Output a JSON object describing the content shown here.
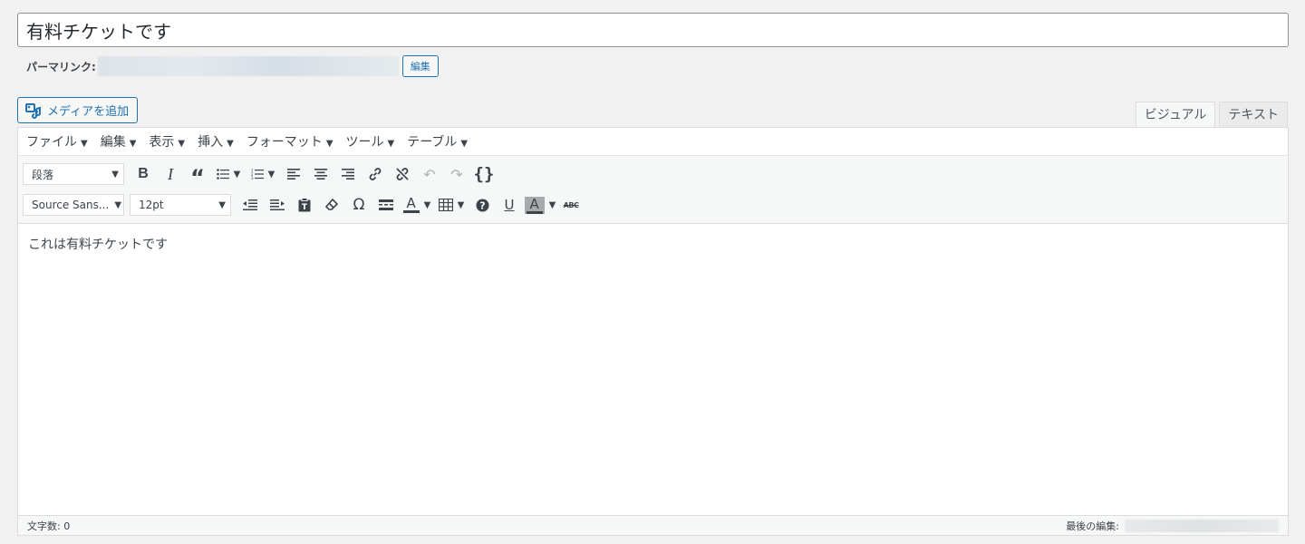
{
  "title": {
    "value": "有料チケットです"
  },
  "permalink": {
    "label": "パーマリンク:",
    "edit_label": "編集"
  },
  "media": {
    "button_label": "メディアを追加"
  },
  "tabs": [
    {
      "label": "ビジュアル",
      "active": true
    },
    {
      "label": "テキスト",
      "active": false
    }
  ],
  "menubar": [
    "ファイル",
    "編集",
    "表示",
    "挿入",
    "フォーマット",
    "ツール",
    "テーブル"
  ],
  "toolbar": {
    "format_select": "段落",
    "font_select": "Source Sans...",
    "size_select": "12pt",
    "row1_icons": [
      "bold-icon",
      "italic-icon",
      "blockquote-icon",
      "bullet-list-icon",
      "numbered-list-icon",
      "align-left-icon",
      "align-center-icon",
      "align-right-icon",
      "link-icon",
      "unlink-icon",
      "undo-icon",
      "redo-icon",
      "code-braces-icon"
    ],
    "row2_icons": [
      "outdent-icon",
      "indent-icon",
      "paste-text-icon",
      "clear-format-icon",
      "special-char-icon",
      "read-more-icon",
      "text-color-icon",
      "table-icon",
      "help-icon",
      "underline-icon",
      "background-color-icon",
      "strikethrough-icon"
    ]
  },
  "content": {
    "text": "これは有料チケットです"
  },
  "status": {
    "word_count": "文字数: 0",
    "last_edited": "最後の編集:"
  },
  "colors": {
    "accent": "#2271b1",
    "border": "#dcdcde",
    "background": "#f1f1f1"
  }
}
